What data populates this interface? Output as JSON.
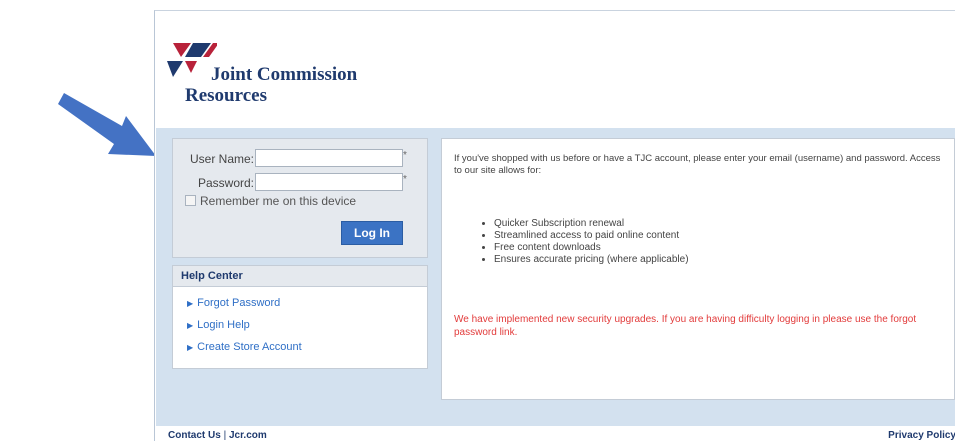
{
  "logo": {
    "name": "Joint Commission",
    "subname": "Resources"
  },
  "login": {
    "username_label": "User Name:",
    "password_label": "Password:",
    "required_marker": "*",
    "remember_label": "Remember me on this device",
    "login_button": "Log In"
  },
  "help": {
    "title": "Help Center",
    "items": [
      {
        "label": "Forgot Password"
      },
      {
        "label": "Login Help"
      },
      {
        "label": "Create Store Account"
      }
    ]
  },
  "info": {
    "intro": "If you've shopped with us before or have a TJC account, please enter your email (username) and password. Access to our site allows for:",
    "benefits": [
      "Quicker Subscription renewal",
      "Streamlined access to paid online content",
      "Free content downloads",
      "Ensures accurate pricing (where applicable)"
    ],
    "notice": "We have implemented new security upgrades. If you are having difficulty logging in please use the forgot password link."
  },
  "footer": {
    "contact": "Contact Us",
    "separator": "|",
    "site": "Jcr.com",
    "privacy": "Privacy Policy"
  },
  "colors": {
    "accent": "#3b73c4",
    "brand_navy": "#1f3a6e",
    "brand_red": "#b8223a",
    "warning": "#e23b3b",
    "panel_bg": "#d3e1ef"
  }
}
